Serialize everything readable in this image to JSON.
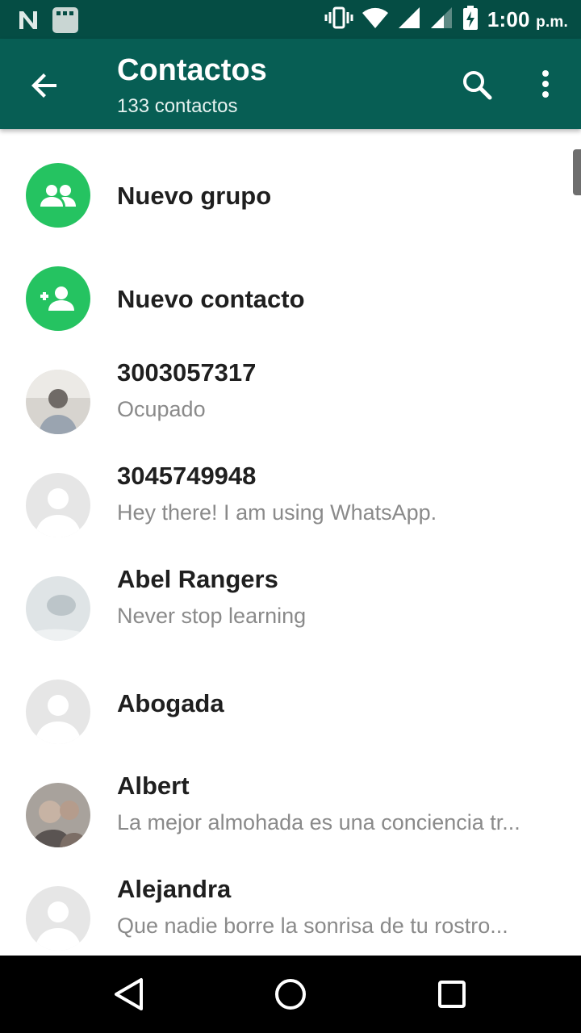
{
  "statusbar": {
    "time": "1:00",
    "ampm": "p.m."
  },
  "appbar": {
    "title": "Contactos",
    "subtitle": "133 contactos"
  },
  "actions": [
    {
      "label": "Nuevo grupo",
      "icon": "group-icon"
    },
    {
      "label": "Nuevo contacto",
      "icon": "add-person-icon"
    }
  ],
  "contacts": [
    {
      "name": "3003057317",
      "status": "Ocupado"
    },
    {
      "name": "3045749948",
      "status": "Hey there! I am using WhatsApp."
    },
    {
      "name": "Abel Rangers",
      "status": "Never stop learning"
    },
    {
      "name": "Abogada",
      "status": ""
    },
    {
      "name": "Albert",
      "status": "La mejor almohada es una conciencia tr..."
    },
    {
      "name": "Alejandra",
      "status": "Que nadie borre la sonrisa de tu rostro..."
    }
  ],
  "colors": {
    "primary_dark": "#054d44",
    "primary": "#075e54",
    "accent_green": "#25c361"
  }
}
